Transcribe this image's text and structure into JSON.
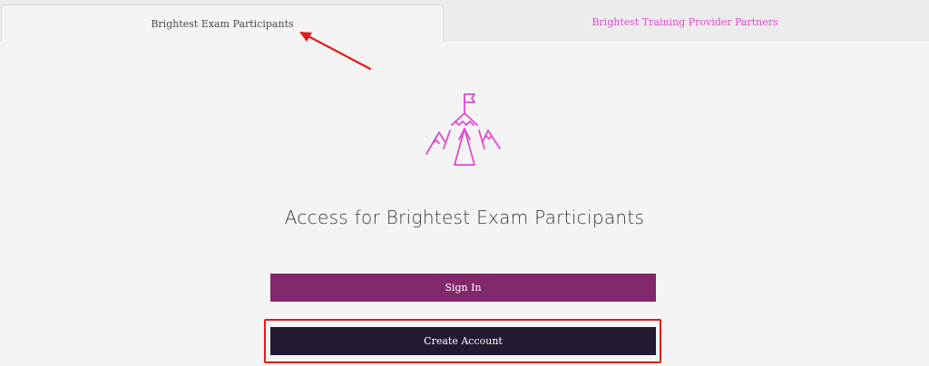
{
  "tabs": [
    {
      "label": "Brightest Exam Participants",
      "active": true
    },
    {
      "label": "Brightest Training Provider Partners",
      "active": false
    }
  ],
  "logo": {
    "icon": "mountain-flag-icon",
    "color": "#e04bd3"
  },
  "main": {
    "title": "Access for Brightest Exam Participants"
  },
  "buttons": {
    "sign_in": "Sign In",
    "create_account": "Create Account"
  },
  "colors": {
    "accent_pink": "#e04bd3",
    "sign_in_bg": "#82286c",
    "create_account_bg": "#231a31",
    "annotation_red": "#e41b1b"
  }
}
